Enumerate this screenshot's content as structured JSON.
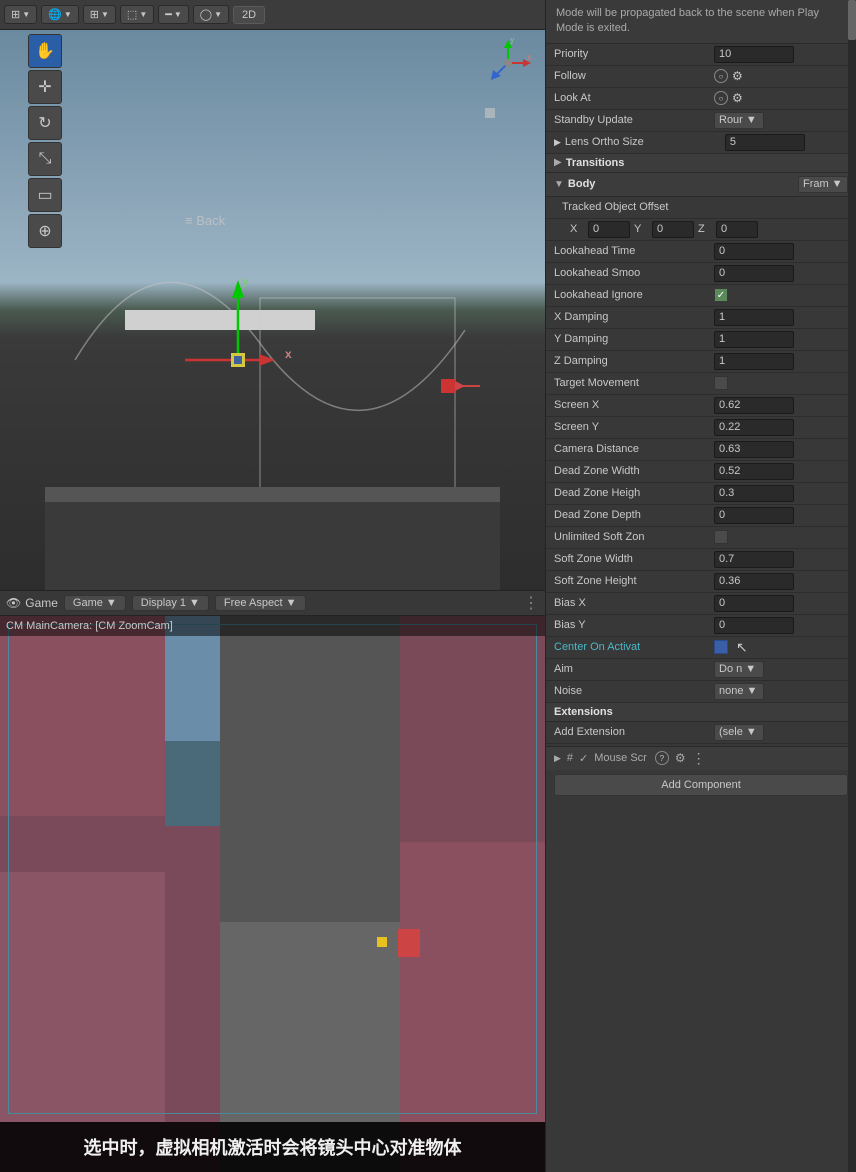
{
  "toolbar": {
    "buttons": [
      "scene-icon",
      "globe-icon",
      "grid-icon",
      "grid2-icon",
      "ruler-icon",
      "circle-icon"
    ],
    "mode_2d": "2D"
  },
  "side_tools": [
    "hand",
    "move",
    "rotate",
    "scale",
    "rect",
    "transform"
  ],
  "scene": {
    "back_label": "≡ Back",
    "axis_y": "y",
    "axis_x": "x"
  },
  "game_toolbar": {
    "title": "Game",
    "game_label": "Game",
    "display_label": "Display 1",
    "aspect_label": "Free Aspect",
    "dots_icon": "⋮"
  },
  "cm_bar": {
    "text": "CM MainCamera: [CM ZoomCam]"
  },
  "bottom_text": "选中时，虚拟相机激活时会将镜头中心对准物体",
  "inspector": {
    "warning_text": "Mode will be propagated back to the scene when Play Mode is exited.",
    "rows": [
      {
        "label": "Priority",
        "value": "10",
        "type": "input"
      },
      {
        "label": "Follow",
        "value": "",
        "type": "circle-gear"
      },
      {
        "label": "Look At",
        "value": "",
        "type": "circle-gear"
      },
      {
        "label": "Standby Update",
        "value": "Rour",
        "type": "dropdown"
      },
      {
        "label": "Lens Ortho Size",
        "value": "5",
        "type": "input"
      },
      {
        "label": "Transitions",
        "value": "",
        "type": "section-expand"
      },
      {
        "label": "Body",
        "value": "Fram",
        "type": "section-dropdown"
      },
      {
        "label": "Tracked Object Offset",
        "value": "",
        "type": "subsection-title"
      },
      {
        "label": "X",
        "value": "0",
        "y": "0",
        "z": "0",
        "type": "xyz"
      },
      {
        "label": "Lookahead Time",
        "value": "0",
        "type": "input"
      },
      {
        "label": "Lookahead Smoo",
        "value": "0",
        "type": "input"
      },
      {
        "label": "Lookahead Ignore",
        "value": true,
        "type": "checkbox"
      },
      {
        "label": "X Damping",
        "value": "1",
        "type": "input"
      },
      {
        "label": "Y Damping",
        "value": "1",
        "type": "input"
      },
      {
        "label": "Z Damping",
        "value": "1",
        "type": "input"
      },
      {
        "label": "Target Movement",
        "value": false,
        "type": "checkbox"
      },
      {
        "label": "Screen X",
        "value": "0.62",
        "type": "input"
      },
      {
        "label": "Screen Y",
        "value": "0.22",
        "type": "input"
      },
      {
        "label": "Camera Distance",
        "value": "0.63",
        "type": "input"
      },
      {
        "label": "Dead Zone Width",
        "value": "0.52",
        "type": "input"
      },
      {
        "label": "Dead Zone Heigh",
        "value": "0.3",
        "type": "input"
      },
      {
        "label": "Dead Zone Depth",
        "value": "0",
        "type": "input"
      },
      {
        "label": "Unlimited Soft Zon",
        "value": false,
        "type": "checkbox"
      },
      {
        "label": "Soft Zone Width",
        "value": "0.7",
        "type": "input"
      },
      {
        "label": "Soft Zone Height",
        "value": "0.36",
        "type": "input"
      },
      {
        "label": "Bias X",
        "value": "0",
        "type": "input"
      },
      {
        "label": "Bias Y",
        "value": "0",
        "type": "input"
      },
      {
        "label": "Center On Activat",
        "value": "checked",
        "type": "checkbox-blue"
      },
      {
        "label": "Aim",
        "value": "Do n",
        "type": "dropdown"
      },
      {
        "label": "Noise",
        "value": "none",
        "type": "dropdown"
      }
    ],
    "extensions_label": "Extensions",
    "add_extension_label": "Add Extension",
    "add_extension_value": "(sele",
    "bottom_bar": {
      "hash_icon": "#",
      "check_icon": "✓",
      "mouse_scr_label": "Mouse Scr",
      "question_icon": "?",
      "settings_icon": "⚙",
      "dots_icon": "⋮"
    },
    "add_component_label": "Add Component"
  }
}
